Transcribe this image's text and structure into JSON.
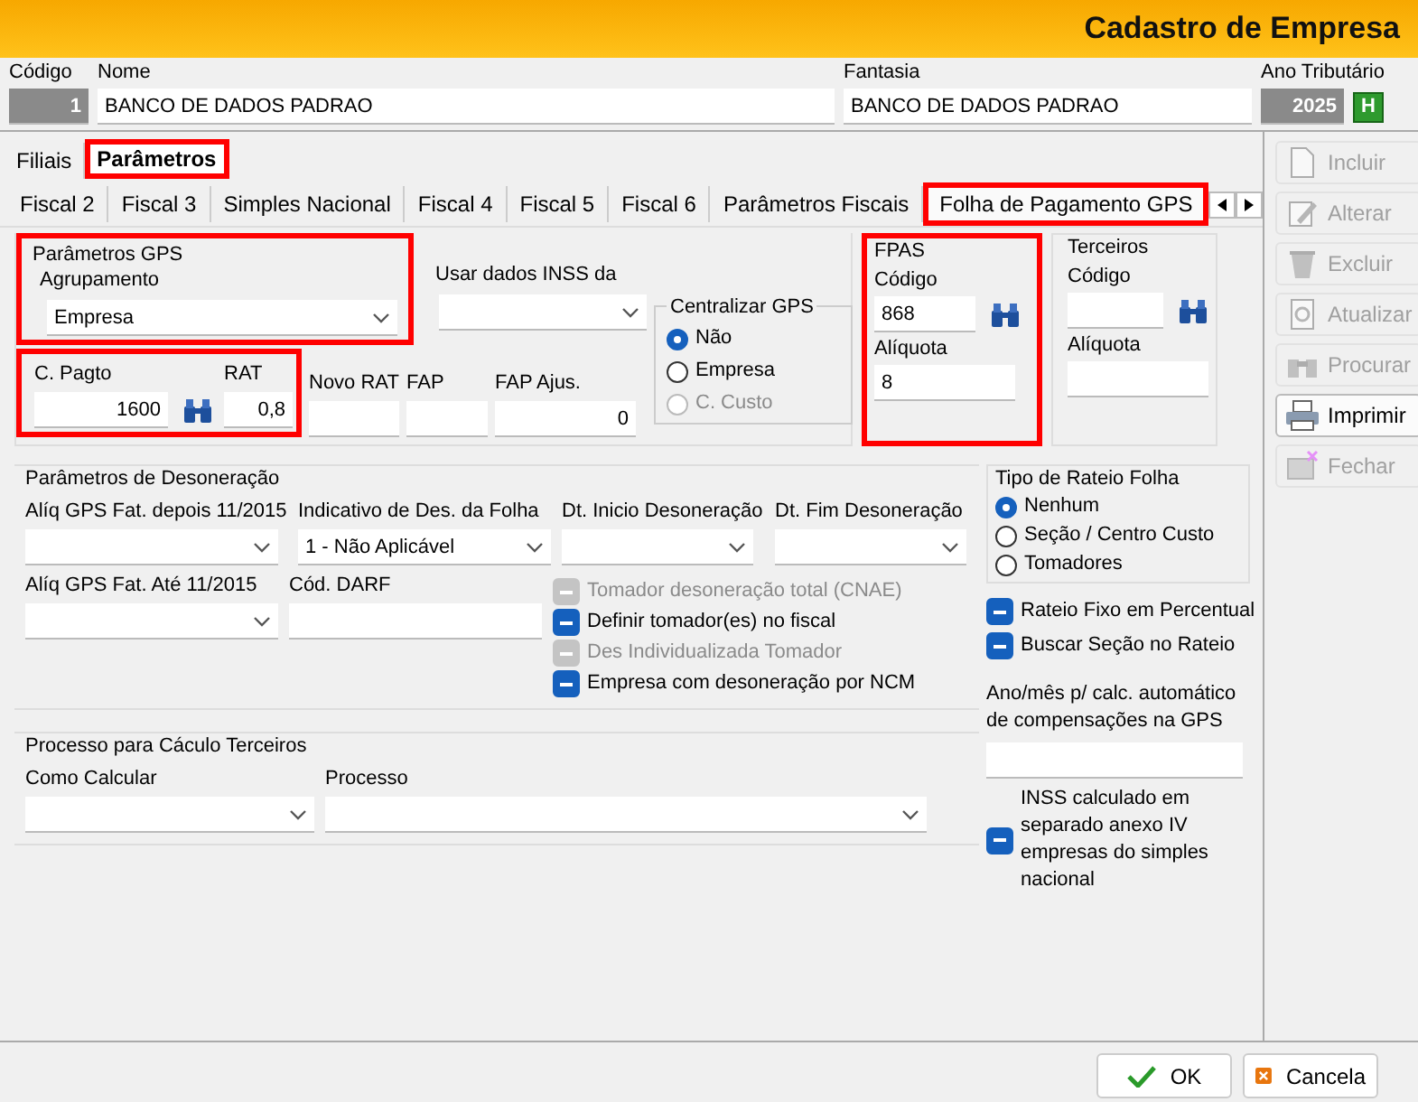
{
  "window": {
    "title": "Cadastro de Empresa"
  },
  "header": {
    "codigo": {
      "label": "Código",
      "value": "1"
    },
    "nome": {
      "label": "Nome",
      "value": "BANCO DE DADOS PADRAO"
    },
    "fantasia": {
      "label": "Fantasia",
      "value": "BANCO DE DADOS PADRAO"
    },
    "ano": {
      "label": "Ano Tributário",
      "value": "2025",
      "button": "H"
    }
  },
  "outer_tabs": [
    {
      "label": "Filiais",
      "selected": false,
      "highlighted": false
    },
    {
      "label": "Parâmetros",
      "selected": true,
      "highlighted": true
    }
  ],
  "inner_tabs": [
    {
      "label": "Fiscal 2",
      "selected": false,
      "highlighted": false
    },
    {
      "label": "Fiscal 3",
      "selected": false,
      "highlighted": false
    },
    {
      "label": "Simples Nacional",
      "selected": false,
      "highlighted": false
    },
    {
      "label": "Fiscal 4",
      "selected": false,
      "highlighted": false
    },
    {
      "label": "Fiscal 5",
      "selected": false,
      "highlighted": false
    },
    {
      "label": "Fiscal 6",
      "selected": false,
      "highlighted": false
    },
    {
      "label": "Parâmetros Fiscais",
      "selected": false,
      "highlighted": false
    },
    {
      "label": "Folha de Pagamento GPS",
      "selected": true,
      "highlighted": true
    }
  ],
  "gps": {
    "title": "Parâmetros GPS",
    "highlighted": true,
    "agrupamento": {
      "label": "Agrupamento",
      "value": "Empresa"
    },
    "usar_inss": {
      "label": "Usar dados INSS da"
    },
    "pagto": {
      "highlighted": true,
      "c_pagto": {
        "label": "C. Pagto",
        "value": "1600"
      },
      "rat": {
        "label": "RAT",
        "value": "0,8"
      }
    },
    "novo_rat": {
      "label": "Novo RAT"
    },
    "fap": {
      "label": "FAP"
    },
    "fap_ajus": {
      "label": "FAP Ajus.",
      "value": "0"
    }
  },
  "centralizar": {
    "title": "Centralizar GPS",
    "options": [
      {
        "label": "Não",
        "selected": true,
        "disabled": false
      },
      {
        "label": "Empresa",
        "selected": false,
        "disabled": false
      },
      {
        "label": "C. Custo",
        "selected": false,
        "disabled": true
      }
    ]
  },
  "fpas": {
    "title": "FPAS",
    "highlighted": true,
    "codigo": {
      "label": "Código",
      "value": "868"
    },
    "aliquota": {
      "label": "Alíquota",
      "value": "8"
    }
  },
  "terceiros": {
    "title": "Terceiros",
    "highlighted": false,
    "codigo": {
      "label": "Código"
    },
    "aliquota": {
      "label": "Alíquota"
    }
  },
  "desoneracao": {
    "title": "Parâmetros de Desoneração",
    "row1": [
      {
        "label": "Alíq GPS Fat. depois 11/2015",
        "kind": "combo"
      },
      {
        "label": "Indicativo de Des. da Folha",
        "kind": "combo",
        "value": "1 - Não Aplicável"
      },
      {
        "label": "Dt. Inicio Desoneração",
        "kind": "combo"
      },
      {
        "label": "Dt. Fim Desoneração",
        "kind": "combo"
      }
    ],
    "row2": [
      {
        "label": "Alíq GPS Fat. Até 11/2015",
        "kind": "combo"
      },
      {
        "label": "Cód. DARF",
        "kind": "text"
      }
    ],
    "checks": [
      {
        "label": "Tomador desoneração total (CNAE)",
        "checked": true,
        "disabled": true
      },
      {
        "label": "Definir tomador(es) no fiscal",
        "checked": true,
        "disabled": false
      },
      {
        "label": "Des Individualizada Tomador",
        "checked": true,
        "disabled": true
      },
      {
        "label": "Empresa com desoneração por NCM",
        "checked": true,
        "disabled": false
      }
    ]
  },
  "processo": {
    "title": "Processo para Cáculo Terceiros",
    "fields": [
      {
        "label": "Como Calcular",
        "kind": "combo"
      },
      {
        "label": "Processo",
        "kind": "combo"
      }
    ]
  },
  "rateio": {
    "title": "Tipo de Rateio Folha",
    "options": [
      {
        "label": "Nenhum",
        "selected": true,
        "disabled": false
      },
      {
        "label": "Seção / Centro Custo",
        "selected": false,
        "disabled": false
      },
      {
        "label": "Tomadores",
        "selected": false,
        "disabled": false
      }
    ]
  },
  "rateio_checks": [
    {
      "label": "Rateio Fixo em Percentual",
      "checked": true,
      "disabled": false
    },
    {
      "label": "Buscar Seção no Rateio",
      "checked": true,
      "disabled": false
    }
  ],
  "compensacao": {
    "label": "Ano/mês p/ calc. automático de compensações na GPS"
  },
  "inss_anexo": {
    "label": "INSS calculado em separado anexo IV empresas do simples nacional",
    "checked": true,
    "disabled": false
  },
  "actions": [
    {
      "label": "Incluir",
      "kind": "document",
      "disabled": true
    },
    {
      "label": "Alterar",
      "kind": "pencil",
      "disabled": true
    },
    {
      "label": "Excluir",
      "kind": "trash",
      "disabled": true
    },
    {
      "label": "Atualizar",
      "kind": "refresh",
      "disabled": true
    },
    {
      "label": "Procurar",
      "kind": "binoculars",
      "disabled": true
    },
    {
      "label": "Imprimir",
      "kind": "printer",
      "disabled": false
    },
    {
      "label": "Fechar",
      "kind": "close",
      "disabled": true
    }
  ],
  "footer_buttons": [
    {
      "label": "OK",
      "kind": "ok"
    },
    {
      "label": "Cancela",
      "kind": "cancel"
    }
  ]
}
